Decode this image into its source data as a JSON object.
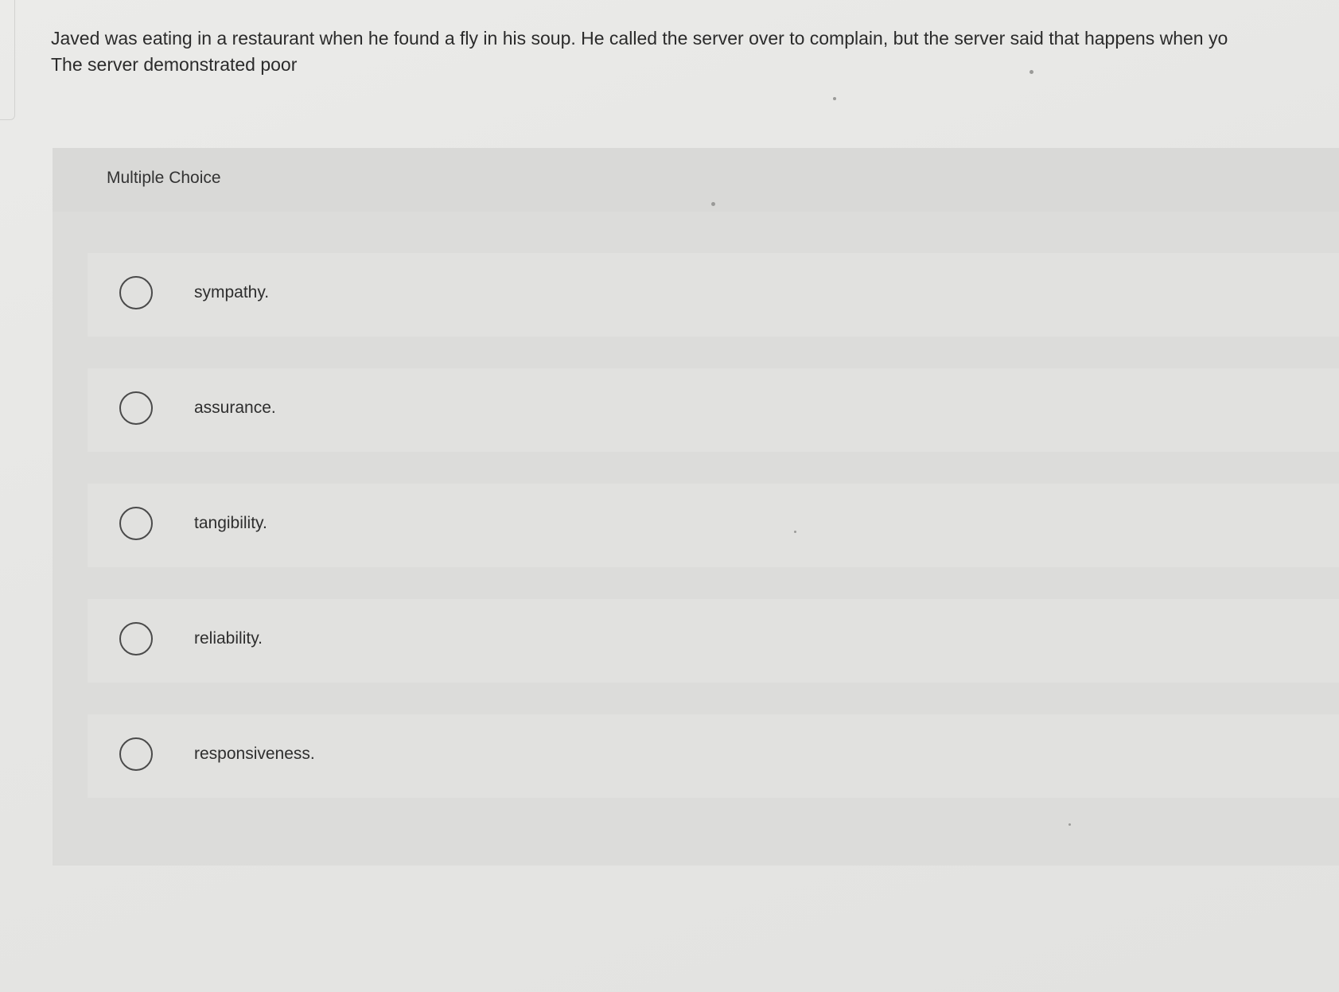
{
  "question": {
    "line1": "Javed was eating in a restaurant when he found a fly in his soup. He called the server over to complain, but the server said that happens when yo",
    "line2": "The server demonstrated poor"
  },
  "panel": {
    "title": "Multiple Choice",
    "choices": [
      {
        "label": "sympathy."
      },
      {
        "label": "assurance."
      },
      {
        "label": "tangibility."
      },
      {
        "label": "reliability."
      },
      {
        "label": "responsiveness."
      }
    ]
  }
}
